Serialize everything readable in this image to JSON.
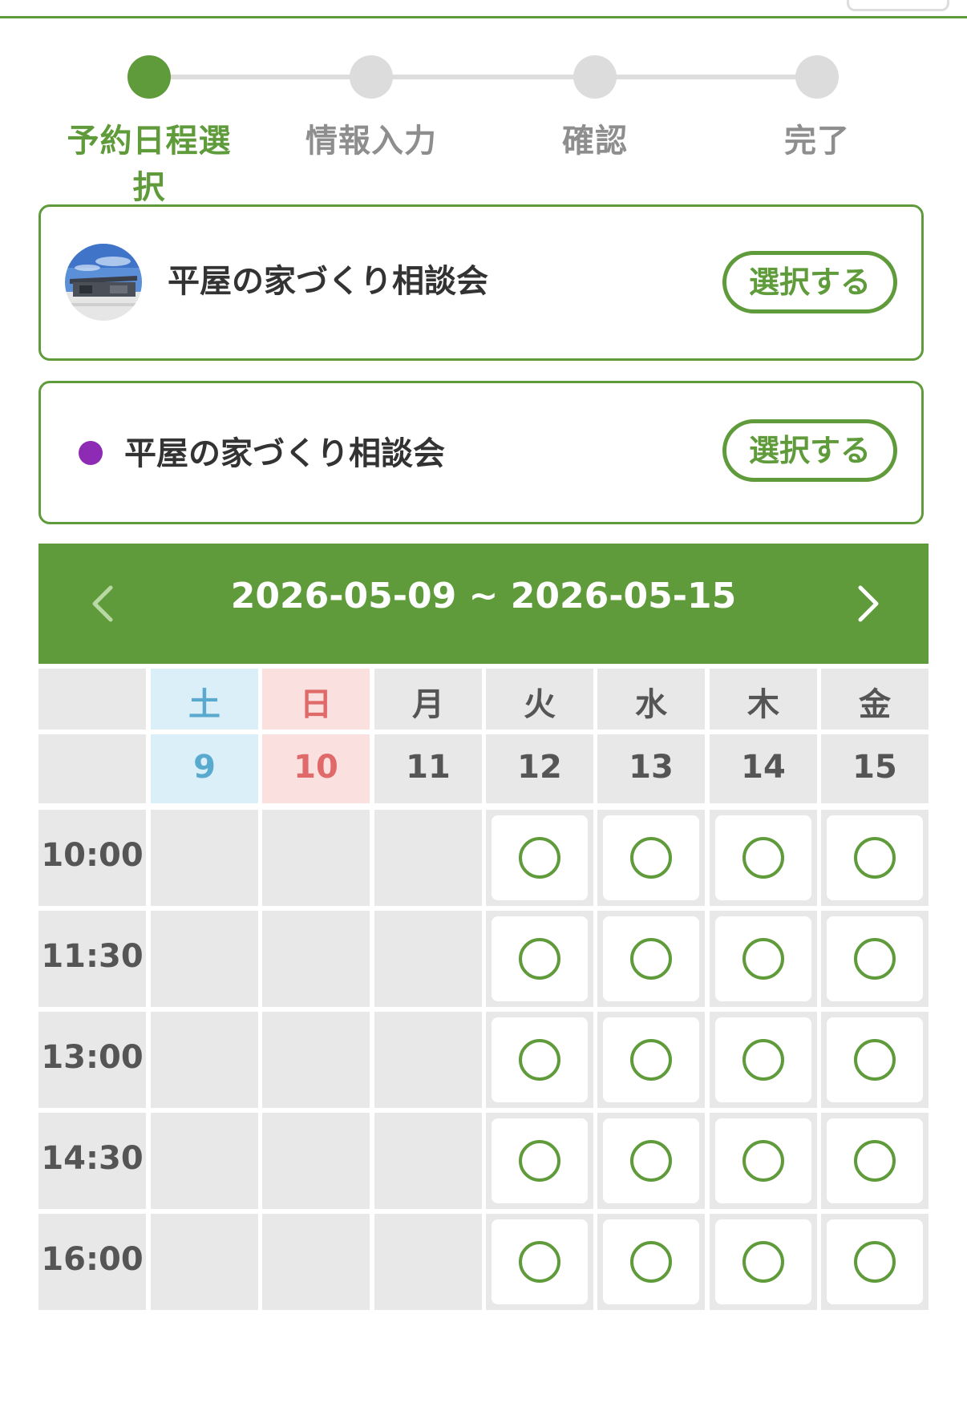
{
  "stepper": {
    "steps": [
      {
        "label": "予約日程選択",
        "state": "active"
      },
      {
        "label": "情報入力",
        "state": "pending"
      },
      {
        "label": "確認",
        "state": "pending"
      },
      {
        "label": "完了",
        "state": "pending"
      }
    ]
  },
  "events": [
    {
      "title": "平屋の家づくり相談会",
      "select_label": "選択する",
      "icon": "house-photo-thumbnail"
    },
    {
      "title": "平屋の家づくり相談会",
      "select_label": "選択する",
      "marker_color": "#8e2bb5"
    }
  ],
  "calendar": {
    "range": "2026-05-09 ~ 2026-05-15",
    "prev_icon": "chevron-left-icon",
    "next_icon": "chevron-right-icon",
    "days": [
      {
        "weekday": "土",
        "date": "9",
        "type": "sat"
      },
      {
        "weekday": "日",
        "date": "10",
        "type": "sun"
      },
      {
        "weekday": "月",
        "date": "11",
        "type": "weekday"
      },
      {
        "weekday": "火",
        "date": "12",
        "type": "weekday"
      },
      {
        "weekday": "水",
        "date": "13",
        "type": "weekday"
      },
      {
        "weekday": "木",
        "date": "14",
        "type": "weekday"
      },
      {
        "weekday": "金",
        "date": "15",
        "type": "weekday"
      }
    ],
    "times": [
      "10:00",
      "11:30",
      "13:00",
      "14:30",
      "16:00"
    ],
    "availability": [
      [
        false,
        false,
        false,
        true,
        true,
        true,
        true
      ],
      [
        false,
        false,
        false,
        true,
        true,
        true,
        true
      ],
      [
        false,
        false,
        false,
        true,
        true,
        true,
        true
      ],
      [
        false,
        false,
        false,
        true,
        true,
        true,
        true
      ],
      [
        false,
        false,
        false,
        true,
        true,
        true,
        true
      ]
    ],
    "available_icon": "circle-available-icon"
  },
  "colors": {
    "accent": "#5f9b3a",
    "saturday_bg": "#dbeff9",
    "sunday_bg": "#fbe0e0",
    "inactive_dot": "#dcdcdc"
  }
}
